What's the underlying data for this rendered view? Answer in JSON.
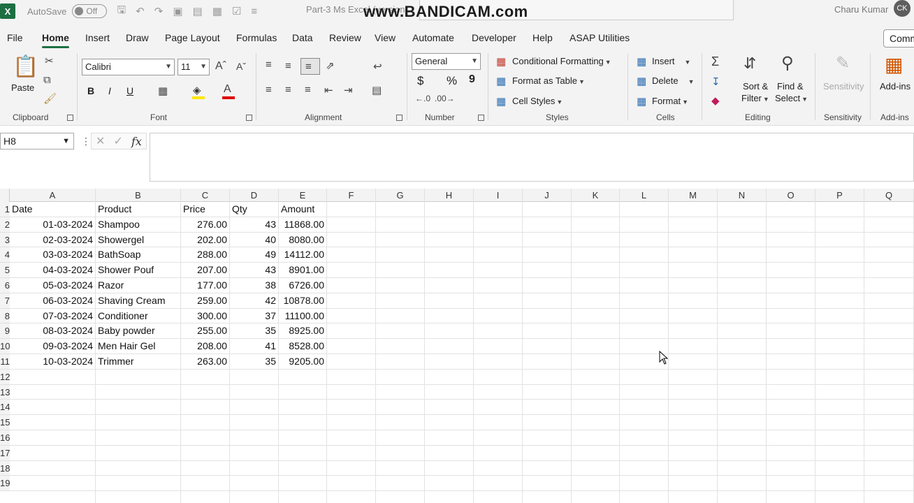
{
  "titlebar": {
    "logo": "X",
    "autosave_label": "AutoSave",
    "autosave_state": "Off",
    "document_title": "Part-3 Ms Excel (version...",
    "watermark": "www.BANDICAM.com",
    "user_name": "Charu Kumar",
    "user_initials": "CK"
  },
  "menu": {
    "tabs": [
      "File",
      "Home",
      "Insert",
      "Draw",
      "Page Layout",
      "Formulas",
      "Data",
      "Review",
      "View",
      "Automate",
      "Developer",
      "Help",
      "ASAP Utilities"
    ],
    "active": "Home",
    "comments": "Comments"
  },
  "ribbon": {
    "clipboard": {
      "label": "Clipboard",
      "paste": "Paste"
    },
    "font": {
      "label": "Font",
      "name": "Calibri",
      "size": "11",
      "bold": "B",
      "italic": "I",
      "underline": "U"
    },
    "alignment": {
      "label": "Alignment"
    },
    "number": {
      "label": "Number",
      "format": "General",
      "currency": "$",
      "percent": "%",
      "comma": "9"
    },
    "styles": {
      "label": "Styles",
      "conditional": "Conditional Formatting",
      "table": "Format as Table",
      "cell_styles": "Cell Styles"
    },
    "cells": {
      "label": "Cells",
      "insert": "Insert",
      "delete": "Delete",
      "format": "Format"
    },
    "editing": {
      "label": "Editing",
      "sort_1": "Sort &",
      "sort_2": "Filter",
      "find_1": "Find &",
      "find_2": "Select"
    },
    "sensitivity": {
      "label": "Sensitivity",
      "button": "Sensitivity"
    },
    "addins": {
      "label": "Add-ins",
      "button": "Add-ins"
    }
  },
  "formula_bar": {
    "name_box": "H8",
    "formula": ""
  },
  "sheet": {
    "columns": [
      "A",
      "B",
      "C",
      "D",
      "E",
      "F",
      "G",
      "H",
      "I",
      "J",
      "K",
      "L",
      "M",
      "N",
      "O",
      "P",
      "Q"
    ],
    "row_numbers": [
      "1",
      "2",
      "3",
      "4",
      "5",
      "6",
      "7",
      "8",
      "9",
      "10",
      "11",
      "12",
      "13",
      "14",
      "15",
      "16",
      "17",
      "18",
      "19"
    ],
    "headers": [
      "Date",
      "Product",
      "Price",
      "Qty",
      "Amount"
    ],
    "rows": [
      [
        "01-03-2024",
        "Shampoo",
        "276.00",
        "43",
        "11868.00"
      ],
      [
        "02-03-2024",
        "Showergel",
        "202.00",
        "40",
        "8080.00"
      ],
      [
        "03-03-2024",
        "BathSoap",
        "288.00",
        "49",
        "14112.00"
      ],
      [
        "04-03-2024",
        "Shower Pouf",
        "207.00",
        "43",
        "8901.00"
      ],
      [
        "05-03-2024",
        "Razor",
        "177.00",
        "38",
        "6726.00"
      ],
      [
        "06-03-2024",
        "Shaving Cream",
        "259.00",
        "42",
        "10878.00"
      ],
      [
        "07-03-2024",
        "Conditioner",
        "300.00",
        "37",
        "11100.00"
      ],
      [
        "08-03-2024",
        "Baby powder",
        "255.00",
        "35",
        "8925.00"
      ],
      [
        "09-03-2024",
        "Men Hair Gel",
        "208.00",
        "41",
        "8528.00"
      ],
      [
        "10-03-2024",
        "Trimmer",
        "263.00",
        "35",
        "9205.00"
      ]
    ]
  }
}
